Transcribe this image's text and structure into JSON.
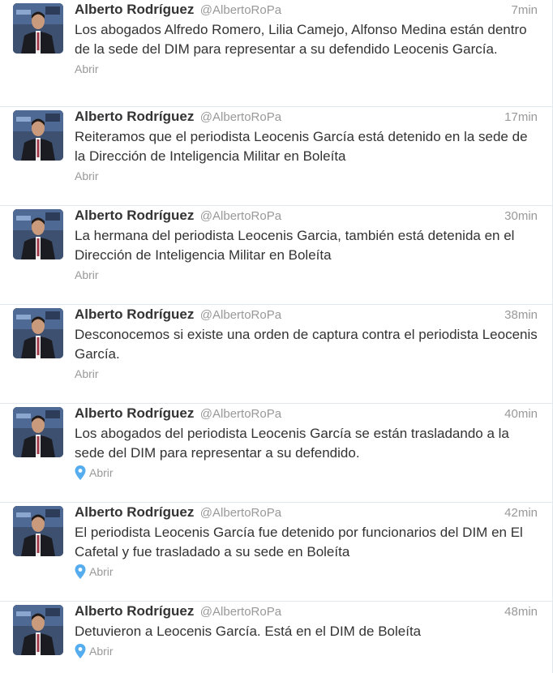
{
  "tweets": [
    {
      "fullname": "Alberto Rodríguez",
      "username": "@AlbertoRoPa",
      "time": "7min",
      "text": "Los abogados Alfredo Romero, Lilia Camejo, Alfonso Medina están dentro de la sede del DIM para representar a su defendido Leocenis García.",
      "open_label": "Abrir",
      "has_geo_icon": false
    },
    {
      "fullname": "Alberto Rodríguez",
      "username": "@AlbertoRoPa",
      "time": "17min",
      "text": "Reiteramos que el periodista Leocenis García está detenido en la sede de la Dirección de Inteligencia Militar en Boleíta",
      "open_label": "Abrir",
      "has_geo_icon": false
    },
    {
      "fullname": "Alberto Rodríguez",
      "username": "@AlbertoRoPa",
      "time": "30min",
      "text": "La hermana del periodista Leocenis Garcia, también está detenida en el Dirección de Inteligencia Militar en Boleíta",
      "open_label": "Abrir",
      "has_geo_icon": false
    },
    {
      "fullname": "Alberto Rodríguez",
      "username": "@AlbertoRoPa",
      "time": "38min",
      "text": "Desconocemos si existe una orden de captura contra el periodista Leocenis García.",
      "open_label": "Abrir",
      "has_geo_icon": false
    },
    {
      "fullname": "Alberto Rodríguez",
      "username": "@AlbertoRoPa",
      "time": "40min",
      "text": "Los abogados del periodista Leocenis García se están trasladando a la sede del DIM para representar a su defendido.",
      "open_label": "Abrir",
      "has_geo_icon": true
    },
    {
      "fullname": "Alberto Rodríguez",
      "username": "@AlbertoRoPa",
      "time": "42min",
      "text": "El periodista Leocenis García fue detenido por funcionarios del DIM en El Cafetal y fue trasladado a su sede en Boleíta",
      "open_label": "Abrir",
      "has_geo_icon": true
    },
    {
      "fullname": "Alberto Rodríguez",
      "username": "@AlbertoRoPa",
      "time": "48min",
      "text": "Detuvieron a Leocenis García. Está en el DIM de Boleíta",
      "open_label": "Abrir",
      "has_geo_icon": true
    }
  ],
  "colors": {
    "text": "#333333",
    "meta": "#999999",
    "geo_icon": "#55acee",
    "divider": "#e1e8ed"
  }
}
